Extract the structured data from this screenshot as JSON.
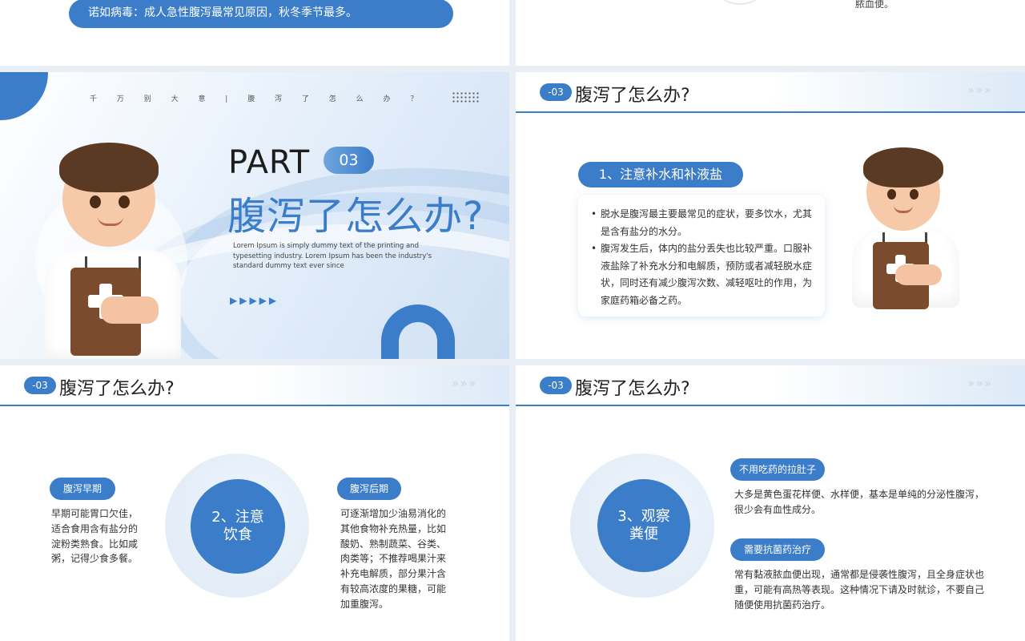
{
  "top_left": {
    "note": "诺如病毒：成人急性腹泻最常见原因，秋冬季节最多。"
  },
  "top_right": {
    "text": "脓血便。"
  },
  "cover": {
    "nav": "千 万 别 大 意 | 腹 泻 了 怎 么 办 ？",
    "part": "PART",
    "num": "03",
    "title": "腹泻了怎么办?",
    "lorem": "Lorem Ipsum is simply dummy text of the printing and typesetting industry. Lorem Ipsum has been the industry's standard dummy text ever since",
    "arrows": "▶▶▶▶▶"
  },
  "section": {
    "num": "-03",
    "title": "腹泻了怎么办?",
    "chevrons": "»»»"
  },
  "p1": {
    "tag": "1、注意补水和补液盐",
    "items": [
      "脱水是腹泻最主要最常见的症状，要多饮水，尤其是含有盐分的水分。",
      "腹泻发生后，体内的盐分丢失也比较严重。口服补液盐除了补充水分和电解质，预防或者减轻脱水症状，同时还有减少腹泻次数、减轻呕吐的作用，为家庭药箱必备之药。"
    ]
  },
  "p2": {
    "circle": "2、注意\n饮食",
    "early": {
      "label": "腹泻早期",
      "text": "早期可能胃口欠佳，适合食用含有盐分的淀粉类熟食。比如咸粥，记得少食多餐。"
    },
    "late": {
      "label": "腹泻后期",
      "text": "可逐渐增加少油易消化的其他食物补充热量，比如酸奶、熟制蔬菜、谷类、肉类等；不推荐喝果汁来补充电解质，部分果汁含有较高浓度的果糖，可能加重腹泻。"
    }
  },
  "p3": {
    "circle": "3、观察\n粪便",
    "a": {
      "label": "不用吃药的拉肚子",
      "text": "大多是黄色蛋花样便、水样便，基本是单纯的分泌性腹泻，很少会有血性成分。"
    },
    "b": {
      "label": "需要抗菌药治疗",
      "text": "常有黏液脓血便出现，通常都是侵袭性腹泻，且全身症状也重，可能有高热等表现。这种情况下请及时就诊，不要自己随便使用抗菌药治疗。"
    }
  },
  "colors": {
    "accent": "#3b7dc8",
    "text": "#333333"
  }
}
